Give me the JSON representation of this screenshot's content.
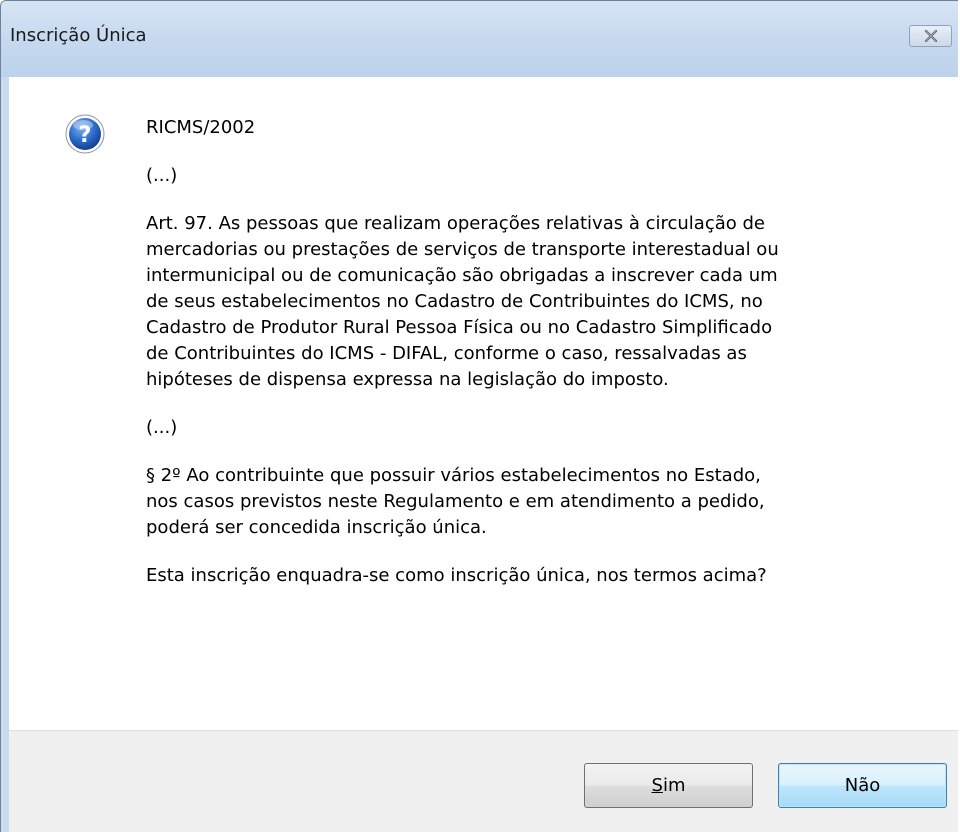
{
  "window": {
    "title": "Inscrição Única",
    "close_icon": "close-x-icon"
  },
  "dialog": {
    "icon": "question-icon",
    "message": {
      "line1": "RICMS/2002",
      "ellipsis1": "(...)",
      "art97": [
        "Art. 97.  As pessoas que realizam operações relativas à circulação de",
        "mercadorias ou prestações de serviços de transporte interestadual ou",
        "intermunicipal ou de comunicação são obrigadas a inscrever cada um",
        "de seus estabelecimentos no Cadastro de Contribuintes do ICMS, no",
        "Cadastro de Produtor Rural Pessoa Física ou no Cadastro Simplificado",
        "de Contribuintes do ICMS - DIFAL, conforme o caso, ressalvadas as",
        "hipóteses de dispensa expressa na legislação do imposto."
      ],
      "ellipsis2": "(...)",
      "par2": [
        "§ 2º  Ao contribuinte que possuir vários estabelecimentos no Estado,",
        "nos casos previstos neste Regulamento e em atendimento a pedido,",
        "poderá ser concedida inscrição única."
      ],
      "question": "Esta inscrição enquadra-se como inscrição única, nos termos acima?"
    }
  },
  "buttons": {
    "yes_mnemonic": "S",
    "yes_rest": "im",
    "no_label": "Não"
  },
  "colors": {
    "titlebar": "#c5d8ee",
    "footer": "#f0f0f0",
    "default_button_border": "#3c7fb1"
  }
}
